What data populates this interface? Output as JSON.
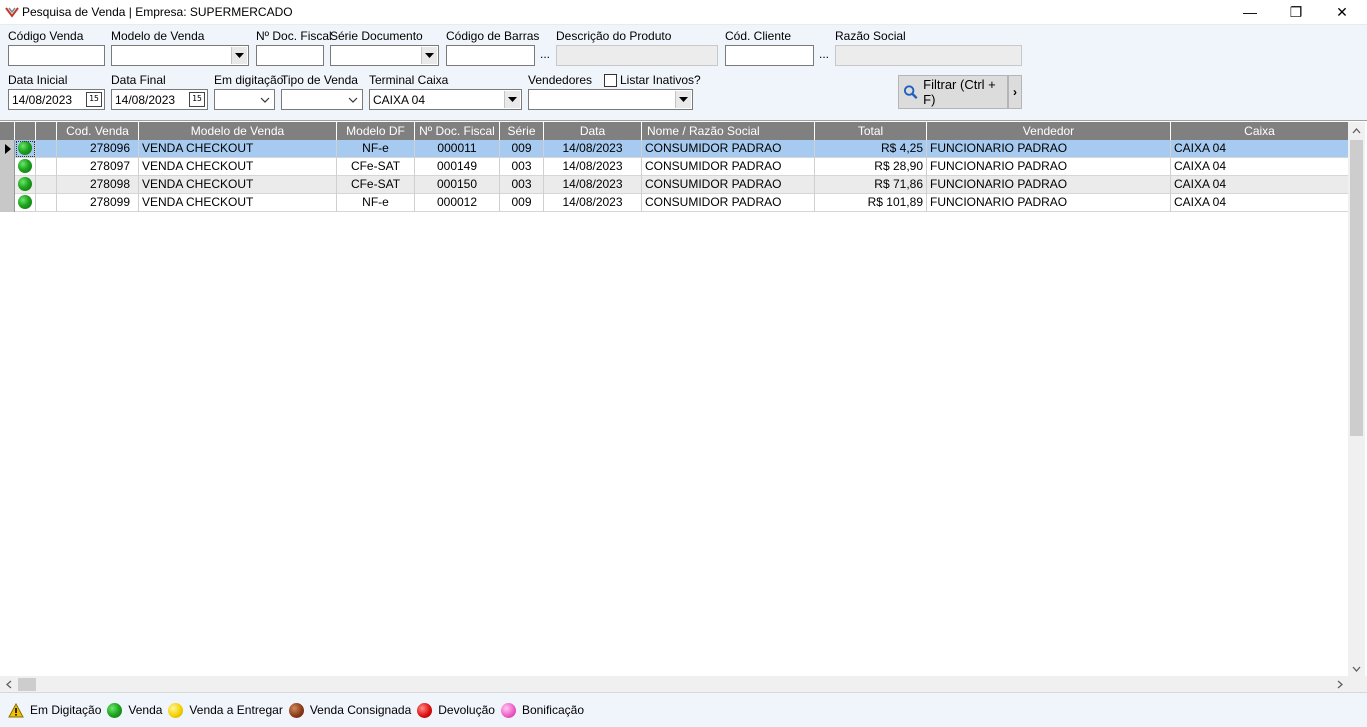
{
  "window": {
    "title": "Pesquisa de Venda | Empresa: SUPERMERCADO",
    "minimize": "—",
    "maximize": "❐",
    "close": "✕"
  },
  "filters": {
    "codigo_venda": {
      "label": "Código Venda",
      "value": ""
    },
    "modelo_venda": {
      "label": "Modelo de Venda",
      "value": ""
    },
    "doc_fiscal": {
      "label": "Nº Doc. Fiscal",
      "value": ""
    },
    "serie_documento": {
      "label": "Série Documento",
      "value": ""
    },
    "codigo_barras": {
      "label": "Código de Barras",
      "value": "",
      "button": "..."
    },
    "descricao_produto": {
      "label": "Descrição do Produto",
      "value": ""
    },
    "cod_cliente": {
      "label": "Cód. Cliente",
      "value": "",
      "button": "..."
    },
    "razao_social": {
      "label": "Razão Social",
      "value": ""
    },
    "data_inicial": {
      "label": "Data Inicial",
      "value": "14/08/2023",
      "cal": "15"
    },
    "data_final": {
      "label": "Data Final",
      "value": "14/08/2023",
      "cal": "15"
    },
    "em_digitacao": {
      "label": "Em digitação",
      "value": ""
    },
    "tipo_venda": {
      "label": "Tipo de Venda",
      "value": ""
    },
    "terminal_caixa": {
      "label": "Terminal Caixa",
      "value": "CAIXA 04"
    },
    "vendedores": {
      "label": "Vendedores",
      "value": ""
    },
    "listar_inativos": {
      "label": "Listar Inativos?",
      "checked": false
    },
    "filter_button": {
      "label": "Filtrar (Ctrl + F)",
      "more": "›"
    }
  },
  "grid": {
    "columns": [
      "",
      "",
      "Cod. Venda",
      "Modelo de Venda",
      "Modelo DF",
      "Nº Doc. Fiscal",
      "Série",
      "Data",
      "Nome / Razão Social",
      "Total",
      "Vendedor",
      "Caixa"
    ],
    "rows": [
      {
        "status": "venda",
        "cod_venda": "278096",
        "modelo_venda": "VENDA CHECKOUT",
        "modelo_df": "NF-e",
        "doc_fiscal": "000011",
        "serie": "009",
        "data": "14/08/2023",
        "nome": "CONSUMIDOR PADRAO",
        "total": "R$ 4,25",
        "vendedor": "FUNCIONARIO PADRAO",
        "caixa": "CAIXA 04"
      },
      {
        "status": "venda",
        "cod_venda": "278097",
        "modelo_venda": "VENDA CHECKOUT",
        "modelo_df": "CFe-SAT",
        "doc_fiscal": "000149",
        "serie": "003",
        "data": "14/08/2023",
        "nome": "CONSUMIDOR PADRAO",
        "total": "R$ 28,90",
        "vendedor": "FUNCIONARIO PADRAO",
        "caixa": "CAIXA 04"
      },
      {
        "status": "venda",
        "cod_venda": "278098",
        "modelo_venda": "VENDA CHECKOUT",
        "modelo_df": "CFe-SAT",
        "doc_fiscal": "000150",
        "serie": "003",
        "data": "14/08/2023",
        "nome": "CONSUMIDOR PADRAO",
        "total": "R$ 71,86",
        "vendedor": "FUNCIONARIO PADRAO",
        "caixa": "CAIXA 04"
      },
      {
        "status": "venda",
        "cod_venda": "278099",
        "modelo_venda": "VENDA CHECKOUT",
        "modelo_df": "NF-e",
        "doc_fiscal": "000012",
        "serie": "009",
        "data": "14/08/2023",
        "nome": "CONSUMIDOR PADRAO",
        "total": "R$ 101,89",
        "vendedor": "FUNCIONARIO PADRAO",
        "caixa": "CAIXA 04"
      }
    ]
  },
  "legend": [
    {
      "label": "Em Digitação",
      "icon": "warning-icon",
      "color": "#f2c200"
    },
    {
      "label": "Venda",
      "icon": "green-dot-icon",
      "color": "#1ea51e"
    },
    {
      "label": "Venda a Entregar",
      "icon": "yellow-dot-icon",
      "color": "#f5d000"
    },
    {
      "label": "Venda Consignada",
      "icon": "brown-dot-icon",
      "color": "#8b3a1a"
    },
    {
      "label": "Devolução",
      "icon": "red-dot-icon",
      "color": "#e01010"
    },
    {
      "label": "Bonificação",
      "icon": "pink-dot-icon",
      "color": "#f060c8"
    }
  ]
}
